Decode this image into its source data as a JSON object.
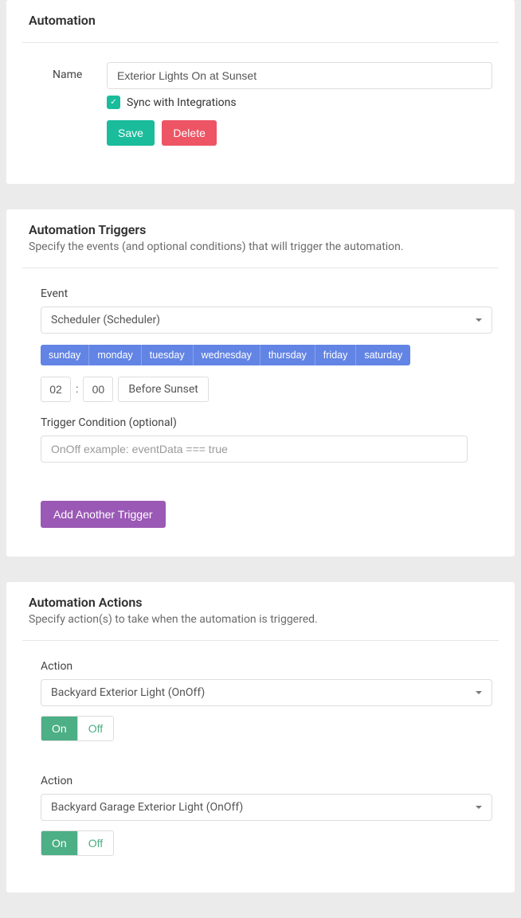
{
  "automation": {
    "title": "Automation",
    "name_label": "Name",
    "name_value": "Exterior Lights On at Sunset",
    "sync_label": "Sync with Integrations",
    "sync_checked": true,
    "save_label": "Save",
    "delete_label": "Delete"
  },
  "triggers": {
    "title": "Automation Triggers",
    "subtitle": "Specify the events (and optional conditions) that will trigger the automation.",
    "event_label": "Event",
    "event_value": "Scheduler (Scheduler)",
    "days": [
      "sunday",
      "monday",
      "tuesday",
      "wednesday",
      "thursday",
      "friday",
      "saturday"
    ],
    "time_hour": "02",
    "time_minute": "00",
    "relative": "Before Sunset",
    "condition_label": "Trigger Condition (optional)",
    "condition_placeholder": "OnOff example: eventData === true",
    "add_another_label": "Add Another Trigger"
  },
  "actions": {
    "title": "Automation Actions",
    "subtitle": "Specify action(s) to take when the automation is triggered.",
    "action_label": "Action",
    "on_label": "On",
    "off_label": "Off",
    "items": [
      {
        "value": "Backyard Exterior Light (OnOff)",
        "state": "On"
      },
      {
        "value": "Backyard Garage Exterior Light (OnOff)",
        "state": "On"
      }
    ]
  }
}
